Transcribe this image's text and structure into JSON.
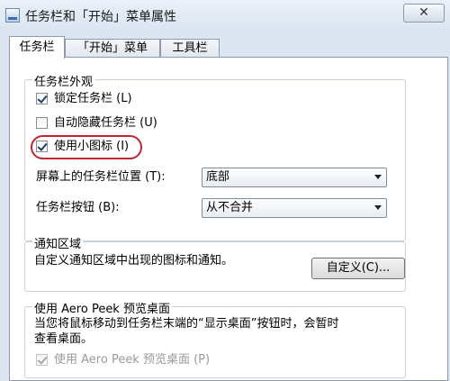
{
  "window": {
    "title": "任务栏和「开始」菜单属性",
    "close_label": "✕"
  },
  "tabs": [
    {
      "label": "任务栏"
    },
    {
      "label": "「开始」菜单"
    },
    {
      "label": "工具栏"
    }
  ],
  "appearance": {
    "title": "任务栏外观",
    "lock_taskbar": {
      "label": "锁定任务栏 (L)",
      "checked": true
    },
    "auto_hide": {
      "label": "自动隐藏任务栏 (U)",
      "checked": false
    },
    "small_icons": {
      "label": "使用小图标 (I)",
      "checked": true
    },
    "location": {
      "label": "屏幕上的任务栏位置 (T):",
      "value": "底部"
    },
    "buttons": {
      "label": "任务栏按钮 (B):",
      "value": "从不合并"
    }
  },
  "notification": {
    "title": "通知区域",
    "description": "自定义通知区域中出现的图标和通知。",
    "customize_label": "自定义(C)..."
  },
  "aero_peek": {
    "title": "使用 Aero Peek 预览桌面",
    "description_line1": "当您将鼠标移动到任务栏末端的“显示桌面”按钮时，会暂时",
    "description_line2": "查看桌面。",
    "checkbox": {
      "label": "使用 Aero Peek 预览桌面 (P)",
      "checked": true,
      "enabled": false
    }
  },
  "colors": {
    "highlight": "#c0262d",
    "window_background": "#dce6f2"
  }
}
